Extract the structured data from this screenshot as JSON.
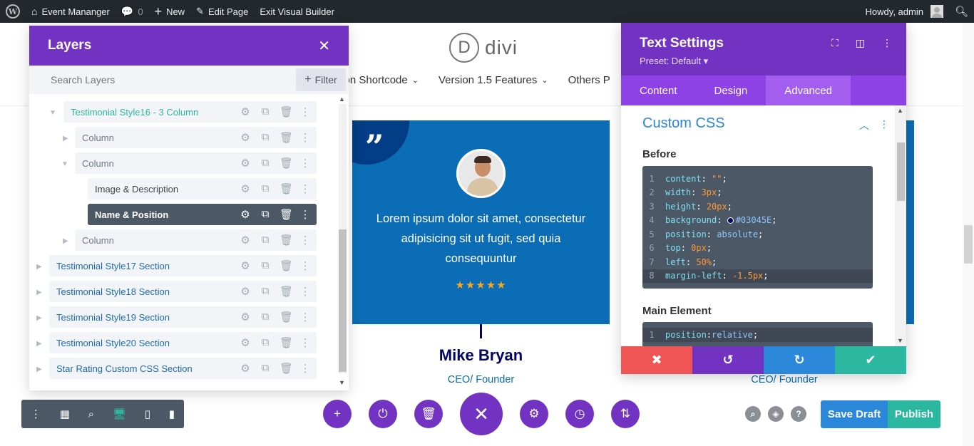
{
  "admin_bar": {
    "site_name": "Event Mananger",
    "comments_count": "0",
    "new_label": "New",
    "edit_page_label": "Edit Page",
    "exit_vb_label": "Exit Visual Builder",
    "howdy": "Howdy, admin"
  },
  "site": {
    "logo_letter": "D",
    "logo_text": "divi",
    "nav": [
      {
        "label": "e on Shortcode"
      },
      {
        "label": "Version 1.5 Features"
      },
      {
        "label": "Others P"
      }
    ]
  },
  "testimonial": {
    "text": "Lorem ipsum dolor sit amet, consectetur adipisicing sit ut fugit, sed quia consequuntur",
    "rating": 5,
    "stars": "★★★★★",
    "name": "Mike Bryan",
    "role": "CEO/ Founder",
    "role_second": "CEO/ Founder",
    "quote_mark": "”"
  },
  "layers": {
    "title": "Layers",
    "search_placeholder": "Search Layers",
    "filter_label": "Filter",
    "rows": [
      {
        "label": "Testimonial Style16 - 3 Column"
      },
      {
        "label": "Column"
      },
      {
        "label": "Column"
      },
      {
        "label": "Image & Description"
      },
      {
        "label": "Name & Position"
      },
      {
        "label": "Column"
      },
      {
        "label": "Testimonial Style17 Section"
      },
      {
        "label": "Testimonial Style18 Section"
      },
      {
        "label": "Testimonial Style19 Section"
      },
      {
        "label": "Testimonial Style20 Section"
      },
      {
        "label": "Star Rating Custom CSS Section"
      }
    ]
  },
  "settings": {
    "title": "Text Settings",
    "preset": "Preset: Default ▾",
    "tabs": [
      {
        "label": "Content"
      },
      {
        "label": "Design"
      },
      {
        "label": "Advanced"
      }
    ],
    "section_title": "Custom CSS",
    "before_label": "Before",
    "main_label": "Main Element",
    "before_code": [
      "content: \"\";",
      "width: 3px;",
      "height: 20px;",
      "background: #03045E;",
      "position: absolute;",
      "top: 0px;",
      "left: 50%;",
      "margin-left: -1.5px;"
    ],
    "main_code": [
      "position:relative;"
    ]
  },
  "footer": {
    "save_draft": "Save Draft",
    "publish": "Publish"
  },
  "colors": {
    "divi_purple": "#7233c2",
    "testimonial_blue": "#0a6db5",
    "navy": "#03045e",
    "save_blue": "#2b87da",
    "publish_green": "#2cb8a0",
    "cancel_red": "#ef5555"
  }
}
